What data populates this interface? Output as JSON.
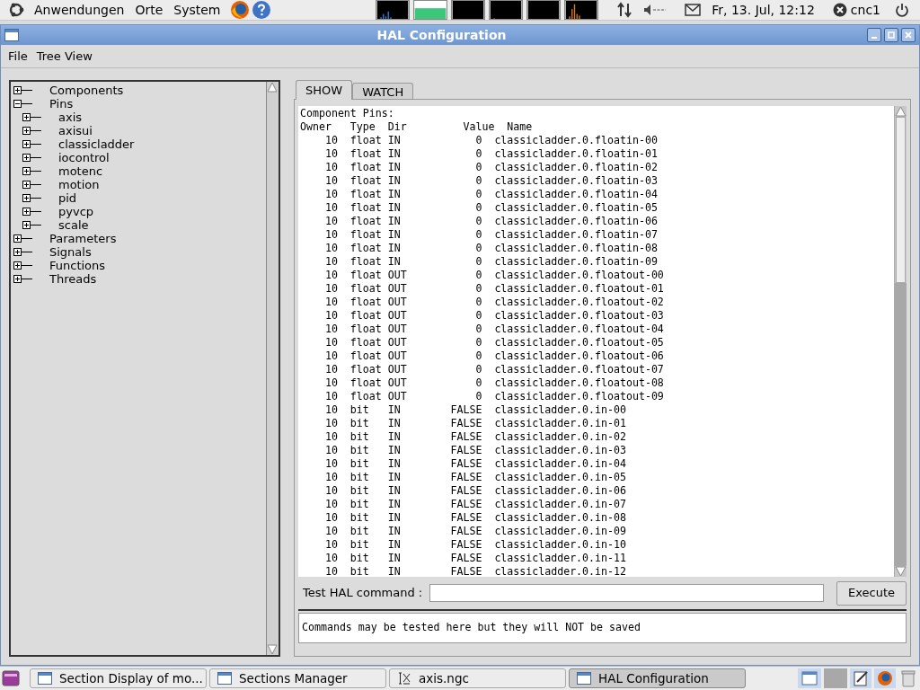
{
  "top_panel": {
    "menus": [
      "Anwendungen",
      "Orte",
      "System"
    ],
    "clock": "Fr, 13. Jul, 12:12",
    "user": "cnc1"
  },
  "window": {
    "title": "HAL Configuration"
  },
  "menu_bar": [
    "File",
    "Tree View"
  ],
  "tree": [
    {
      "label": "Components",
      "expanded": false
    },
    {
      "label": "Pins",
      "expanded": true,
      "children": [
        {
          "label": "axis",
          "expanded": false
        },
        {
          "label": "axisui",
          "expanded": false
        },
        {
          "label": "classicladder",
          "expanded": false
        },
        {
          "label": "iocontrol",
          "expanded": false
        },
        {
          "label": "motenc",
          "expanded": false
        },
        {
          "label": "motion",
          "expanded": false
        },
        {
          "label": "pid",
          "expanded": false
        },
        {
          "label": "pyvcp",
          "expanded": false
        },
        {
          "label": "scale",
          "expanded": false
        }
      ]
    },
    {
      "label": "Parameters",
      "expanded": false
    },
    {
      "label": "Signals",
      "expanded": false
    },
    {
      "label": "Functions",
      "expanded": false
    },
    {
      "label": "Threads",
      "expanded": false
    }
  ],
  "tabs": [
    {
      "label": "SHOW",
      "selected": true
    },
    {
      "label": "WATCH",
      "selected": false
    }
  ],
  "output": {
    "lines": [
      "Component Pins:",
      "Owner   Type  Dir         Value  Name",
      "    10  float IN            0  classicladder.0.floatin-00",
      "    10  float IN            0  classicladder.0.floatin-01",
      "    10  float IN            0  classicladder.0.floatin-02",
      "    10  float IN            0  classicladder.0.floatin-03",
      "    10  float IN            0  classicladder.0.floatin-04",
      "    10  float IN            0  classicladder.0.floatin-05",
      "    10  float IN            0  classicladder.0.floatin-06",
      "    10  float IN            0  classicladder.0.floatin-07",
      "    10  float IN            0  classicladder.0.floatin-08",
      "    10  float IN            0  classicladder.0.floatin-09",
      "    10  float OUT           0  classicladder.0.floatout-00",
      "    10  float OUT           0  classicladder.0.floatout-01",
      "    10  float OUT           0  classicladder.0.floatout-02",
      "    10  float OUT           0  classicladder.0.floatout-03",
      "    10  float OUT           0  classicladder.0.floatout-04",
      "    10  float OUT           0  classicladder.0.floatout-05",
      "    10  float OUT           0  classicladder.0.floatout-06",
      "    10  float OUT           0  classicladder.0.floatout-07",
      "    10  float OUT           0  classicladder.0.floatout-08",
      "    10  float OUT           0  classicladder.0.floatout-09",
      "    10  bit   IN        FALSE  classicladder.0.in-00",
      "    10  bit   IN        FALSE  classicladder.0.in-01",
      "    10  bit   IN        FALSE  classicladder.0.in-02",
      "    10  bit   IN        FALSE  classicladder.0.in-03",
      "    10  bit   IN        FALSE  classicladder.0.in-04",
      "    10  bit   IN        FALSE  classicladder.0.in-05",
      "    10  bit   IN        FALSE  classicladder.0.in-06",
      "    10  bit   IN        FALSE  classicladder.0.in-07",
      "    10  bit   IN        FALSE  classicladder.0.in-08",
      "    10  bit   IN        FALSE  classicladder.0.in-09",
      "    10  bit   IN        FALSE  classicladder.0.in-10",
      "    10  bit   IN        FALSE  classicladder.0.in-11",
      "    10  bit   IN        FALSE  classicladder.0.in-12"
    ]
  },
  "command": {
    "label": "Test HAL command :",
    "button": "Execute",
    "message": "Commands may be tested here but they will NOT be saved"
  },
  "taskbar": [
    {
      "label": "Section Display of mo...",
      "kind": "window",
      "selected": false
    },
    {
      "label": "Sections Manager",
      "kind": "window",
      "selected": false
    },
    {
      "label": "axis.ngc",
      "kind": "editor",
      "selected": false
    },
    {
      "label": "HAL Configuration",
      "kind": "window",
      "selected": true
    }
  ]
}
